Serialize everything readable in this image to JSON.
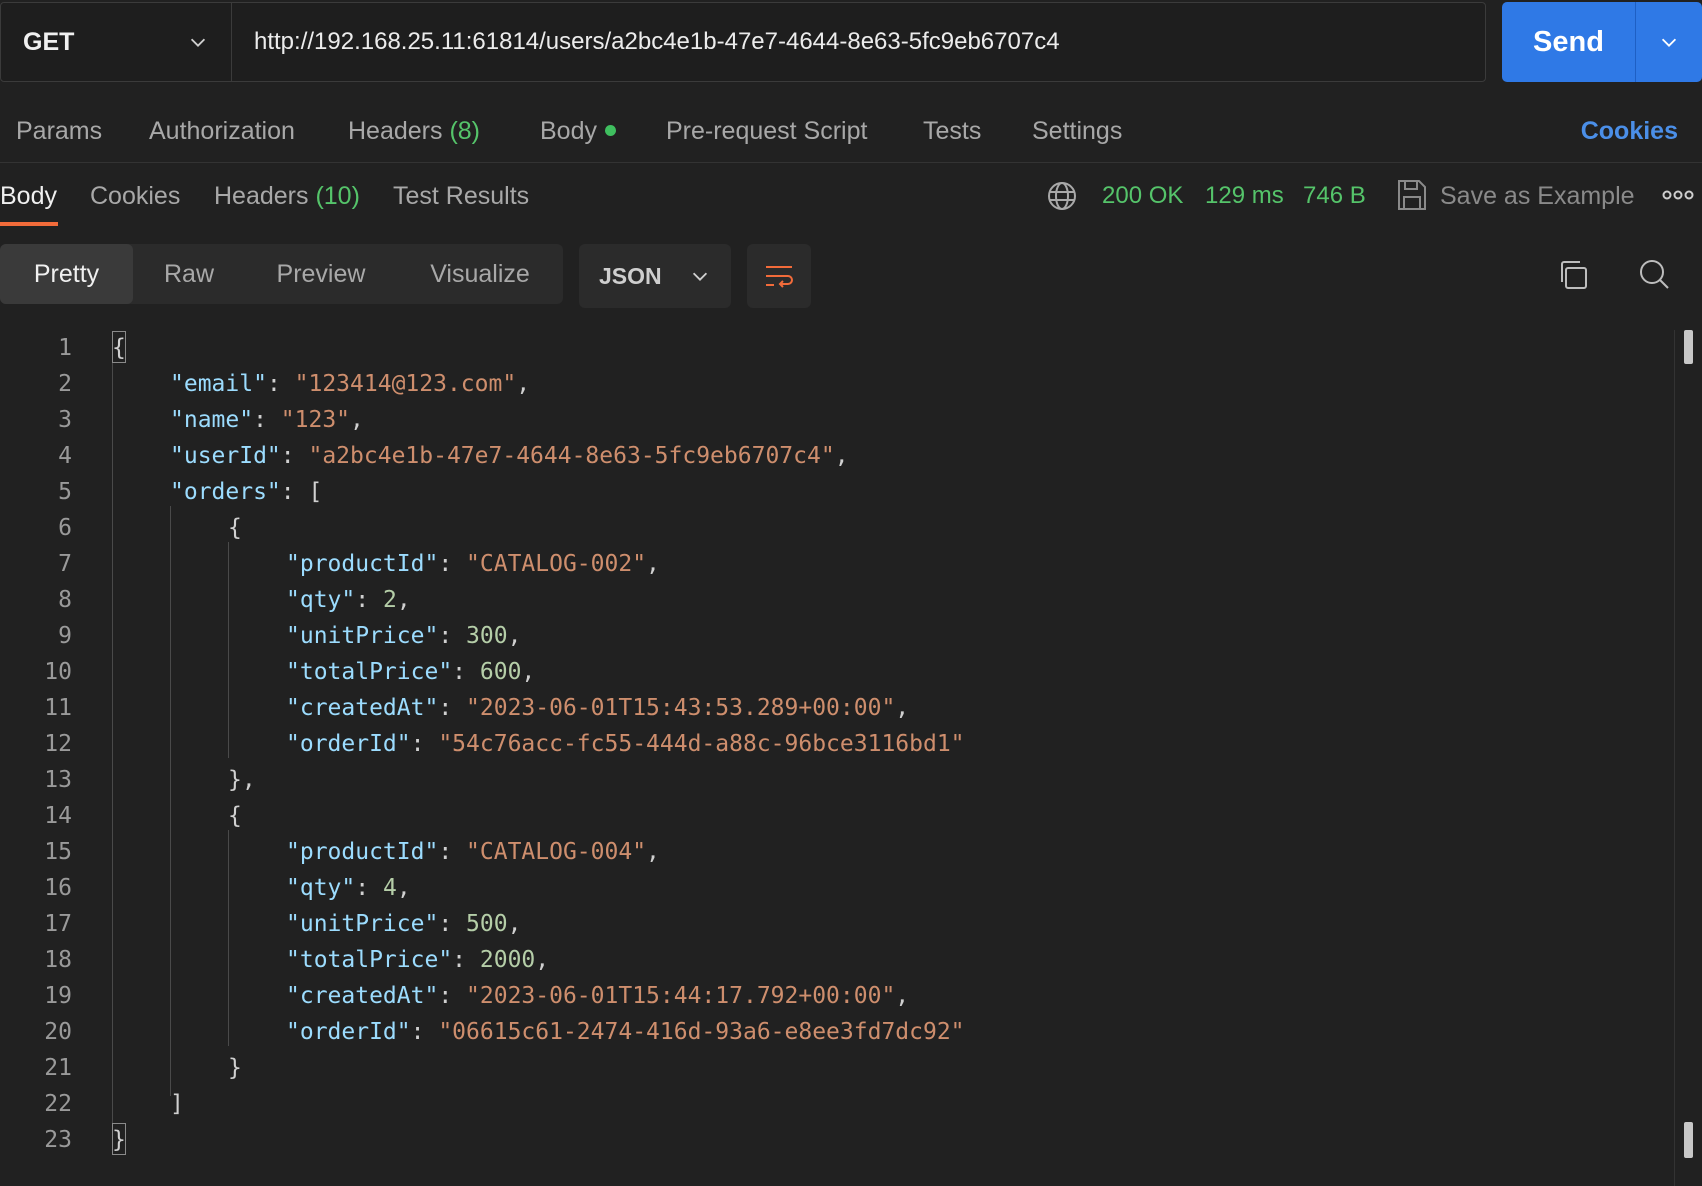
{
  "request": {
    "method": "GET",
    "url": "http://192.168.25.11:61814/users/a2bc4e1b-47e7-4644-8e63-5fc9eb6707c4",
    "send_label": "Send"
  },
  "request_tabs": {
    "params": "Params",
    "authorization": "Authorization",
    "headers": "Headers",
    "headers_count": "(8)",
    "body": "Body",
    "prerequest": "Pre-request Script",
    "tests": "Tests",
    "settings": "Settings",
    "cookies": "Cookies"
  },
  "response_tabs": {
    "body": "Body",
    "cookies": "Cookies",
    "headers": "Headers",
    "headers_count": "(10)",
    "test_results": "Test Results"
  },
  "response_status": {
    "status": "200 OK",
    "time": "129 ms",
    "size": "746 B",
    "save_label": "Save as Example"
  },
  "view_tabs": {
    "pretty": "Pretty",
    "raw": "Raw",
    "preview": "Preview",
    "visualize": "Visualize",
    "format": "JSON"
  },
  "code": {
    "line_numbers": [
      "1",
      "2",
      "3",
      "4",
      "5",
      "6",
      "7",
      "8",
      "9",
      "10",
      "11",
      "12",
      "13",
      "14",
      "15",
      "16",
      "17",
      "18",
      "19",
      "20",
      "21",
      "22",
      "23"
    ],
    "email_key": "\"email\"",
    "email_val": "\"123414@123.com\"",
    "name_key": "\"name\"",
    "name_val": "\"123\"",
    "userId_key": "\"userId\"",
    "userId_val": "\"a2bc4e1b-47e7-4644-8e63-5fc9eb6707c4\"",
    "orders_key": "\"orders\"",
    "orders": [
      {
        "productId_key": "\"productId\"",
        "productId_val": "\"CATALOG-002\"",
        "qty_key": "\"qty\"",
        "qty_val": "2",
        "unitPrice_key": "\"unitPrice\"",
        "unitPrice_val": "300",
        "totalPrice_key": "\"totalPrice\"",
        "totalPrice_val": "600",
        "createdAt_key": "\"createdAt\"",
        "createdAt_val": "\"2023-06-01T15:43:53.289+00:00\"",
        "orderId_key": "\"orderId\"",
        "orderId_val": "\"54c76acc-fc55-444d-a88c-96bce3116bd1\""
      },
      {
        "productId_key": "\"productId\"",
        "productId_val": "\"CATALOG-004\"",
        "qty_key": "\"qty\"",
        "qty_val": "4",
        "unitPrice_key": "\"unitPrice\"",
        "unitPrice_val": "500",
        "totalPrice_key": "\"totalPrice\"",
        "totalPrice_val": "2000",
        "createdAt_key": "\"createdAt\"",
        "createdAt_val": "\"2023-06-01T15:44:17.792+00:00\"",
        "orderId_key": "\"orderId\"",
        "orderId_val": "\"06615c61-2474-416d-93a6-e8ee3fd7dc92\""
      }
    ]
  },
  "colors": {
    "accent": "#2f79e6",
    "status_green": "#55c46a",
    "active_tab_underline": "#f26b3a",
    "json_key": "#9cdcfe",
    "json_string": "#ce8e6d",
    "json_number": "#b5cea8"
  },
  "icons": [
    "chevron-down-icon",
    "globe-icon",
    "save-icon",
    "more-icon",
    "wrap-lines-icon",
    "copy-icon",
    "search-icon"
  ]
}
